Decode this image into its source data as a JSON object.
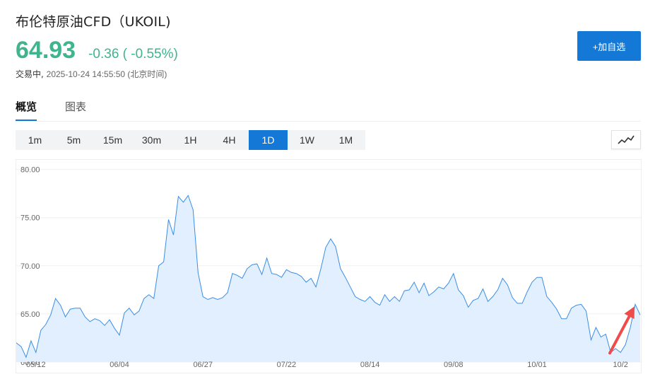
{
  "header": {
    "title": "布伦特原油CFD（UKOIL)",
    "price": "64.93",
    "change": "-0.36 ( -0.55%)",
    "status_label": "交易中,",
    "timestamp": "2025-10-24 14:55:50 (北京时间)",
    "add_watchlist_label": "+加自选"
  },
  "tabs": [
    {
      "label": "概览",
      "active": true
    },
    {
      "label": "图表",
      "active": false
    }
  ],
  "periods": [
    {
      "label": "1m",
      "active": false
    },
    {
      "label": "5m",
      "active": false
    },
    {
      "label": "15m",
      "active": false
    },
    {
      "label": "30m",
      "active": false
    },
    {
      "label": "1H",
      "active": false
    },
    {
      "label": "4H",
      "active": false
    },
    {
      "label": "1D",
      "active": true
    },
    {
      "label": "1W",
      "active": false
    },
    {
      "label": "1M",
      "active": false
    }
  ],
  "colors": {
    "up_green": "#3fb48d",
    "accent_blue": "#1478d7",
    "line": "#3a8ee6",
    "area": "#e1efff",
    "arrow": "#f04b4b"
  },
  "chart_data": {
    "type": "area",
    "ylim": [
      60,
      81
    ],
    "yticks": [
      "80.00",
      "75.00",
      "70.00",
      "65.00",
      "60.00"
    ],
    "ytick_values": [
      80,
      75,
      70,
      65,
      60
    ],
    "xticks": [
      "05/12",
      "06/04",
      "06/27",
      "07/22",
      "08/14",
      "09/08",
      "10/01",
      "10/2"
    ],
    "xtick_index": [
      4,
      21,
      38,
      55,
      72,
      89,
      106,
      123
    ],
    "grid": true,
    "annotation": "red arrow pointing to latest price",
    "series": [
      {
        "values": [
          62.0,
          61.6,
          60.5,
          62.2,
          61.0,
          63.3,
          63.9,
          64.9,
          66.6,
          65.9,
          64.7,
          65.5,
          65.6,
          65.6,
          64.7,
          64.2,
          64.5,
          64.3,
          63.8,
          64.4,
          63.5,
          62.8,
          65.1,
          65.6,
          64.9,
          65.3,
          66.6,
          67.0,
          66.6,
          70.0,
          70.4,
          74.8,
          73.2,
          77.2,
          76.6,
          77.3,
          75.8,
          69.3,
          66.8,
          66.5,
          66.7,
          66.5,
          66.7,
          67.2,
          69.2,
          69.0,
          68.7,
          69.7,
          70.1,
          70.2,
          69.1,
          70.8,
          69.2,
          69.1,
          68.8,
          69.6,
          69.3,
          69.2,
          68.9,
          68.3,
          68.7,
          67.8,
          69.7,
          71.9,
          72.8,
          72.0,
          69.7,
          68.8,
          67.8,
          66.8,
          66.5,
          66.3,
          66.8,
          66.2,
          65.9,
          67.0,
          66.3,
          66.8,
          66.3,
          67.4,
          67.5,
          68.3,
          67.2,
          68.2,
          66.9,
          67.3,
          67.8,
          67.6,
          68.2,
          69.2,
          67.5,
          66.9,
          65.7,
          66.4,
          66.6,
          67.6,
          66.3,
          66.8,
          67.5,
          68.7,
          68.0,
          66.7,
          66.1,
          66.1,
          67.3,
          68.3,
          68.8,
          68.8,
          66.8,
          66.2,
          65.5,
          64.5,
          64.5,
          65.6,
          65.9,
          66.0,
          65.3,
          62.3,
          63.6,
          62.6,
          62.9,
          61.0,
          61.4,
          61.0,
          61.8,
          63.6,
          66.0,
          64.9
        ]
      }
    ]
  }
}
